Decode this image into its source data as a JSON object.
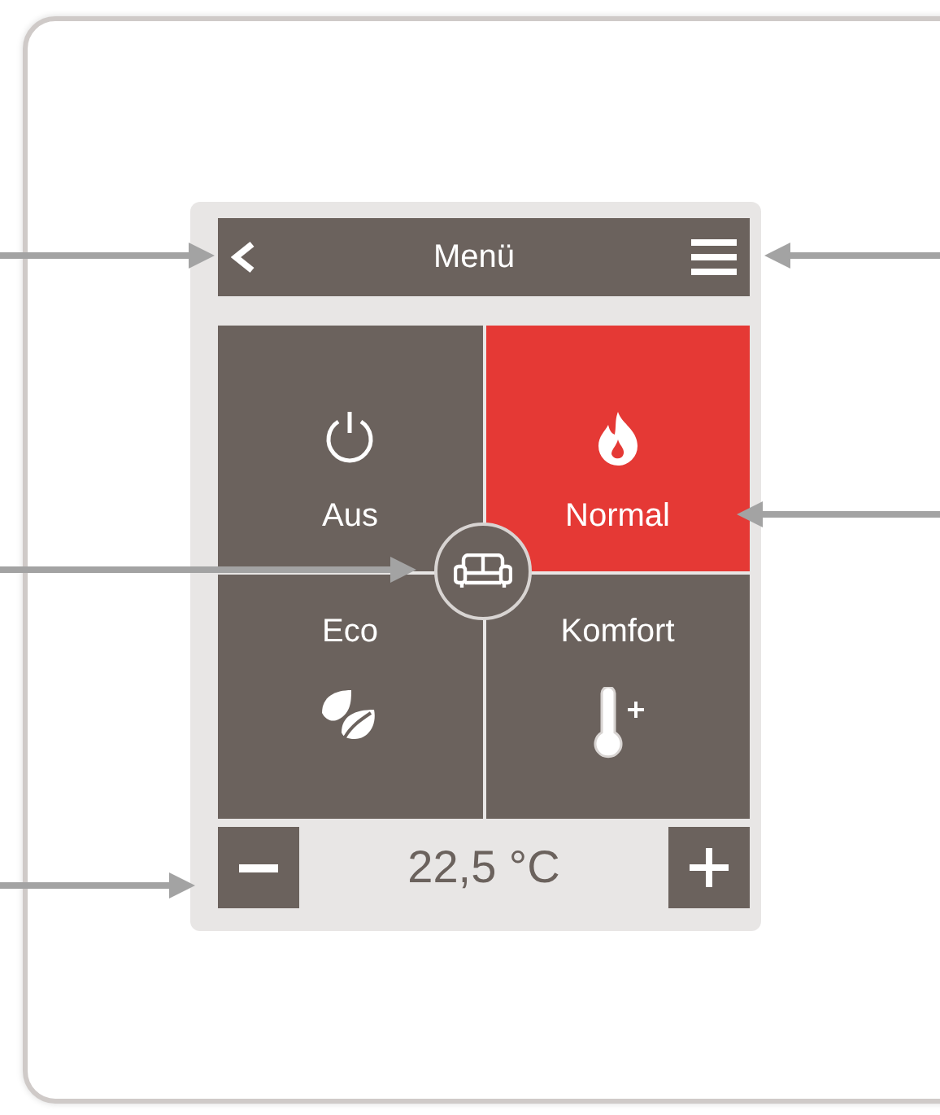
{
  "header": {
    "title": "Menü"
  },
  "modes": [
    {
      "label": "Aus",
      "kind": "power",
      "selected": false
    },
    {
      "label": "Normal",
      "kind": "flame",
      "selected": true
    },
    {
      "label": "Eco",
      "kind": "leaf",
      "selected": false
    },
    {
      "label": "Komfort",
      "kind": "thermometer",
      "selected": false
    }
  ],
  "temperature": "22,5 °C"
}
